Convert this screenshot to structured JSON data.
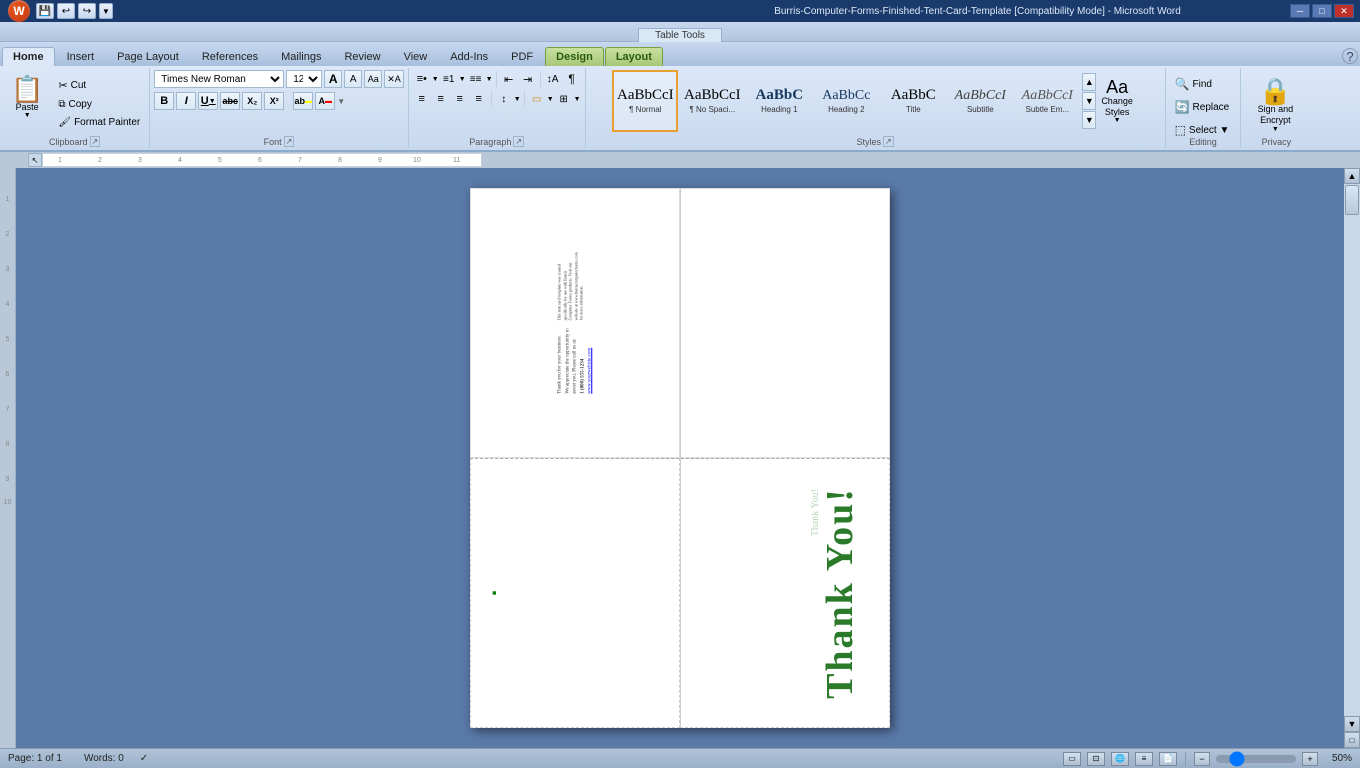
{
  "titlebar": {
    "title": "Burris-Computer-Forms-Finished-Tent-Card-Template [Compatibility Mode] - Microsoft Word",
    "win_min": "─",
    "win_max": "□",
    "win_close": "✕"
  },
  "quickaccess": {
    "save_label": "💾",
    "undo_label": "↩",
    "redo_label": "↪",
    "customize_label": "▼"
  },
  "tabletools": {
    "label": "Table Tools"
  },
  "tabs": [
    {
      "id": "home",
      "label": "Home",
      "active": true,
      "contextual": false
    },
    {
      "id": "insert",
      "label": "Insert",
      "active": false,
      "contextual": false
    },
    {
      "id": "pagelayout",
      "label": "Page Layout",
      "active": false,
      "contextual": false
    },
    {
      "id": "references",
      "label": "References",
      "active": false,
      "contextual": false
    },
    {
      "id": "mailings",
      "label": "Mailings",
      "active": false,
      "contextual": false
    },
    {
      "id": "review",
      "label": "Review",
      "active": false,
      "contextual": false
    },
    {
      "id": "view",
      "label": "View",
      "active": false,
      "contextual": false
    },
    {
      "id": "addins",
      "label": "Add-Ins",
      "active": false,
      "contextual": false
    },
    {
      "id": "pdf",
      "label": "PDF",
      "active": false,
      "contextual": false
    },
    {
      "id": "design",
      "label": "Design",
      "active": false,
      "contextual": true
    },
    {
      "id": "layout",
      "label": "Layout",
      "active": false,
      "contextual": true
    }
  ],
  "ribbon": {
    "clipboard": {
      "group_label": "Clipboard",
      "paste_label": "Paste",
      "cut_label": "Cut",
      "copy_label": "Copy",
      "format_painter_label": "Format Painter"
    },
    "font": {
      "group_label": "Font",
      "font_name": "Times New Roman",
      "font_size": "12",
      "grow_label": "A",
      "shrink_label": "A",
      "clear_label": "Aa",
      "bold_label": "B",
      "italic_label": "I",
      "underline_label": "U",
      "strikethrough_label": "abc",
      "subscript_label": "X₂",
      "superscript_label": "X²",
      "highlight_label": "ab",
      "color_label": "A"
    },
    "paragraph": {
      "group_label": "Paragraph",
      "bullets_label": "≡•",
      "numbering_label": "≡1",
      "multilevel_label": "≡≡",
      "decrease_indent_label": "⇤",
      "increase_indent_label": "⇥",
      "sort_label": "↕A",
      "show_hide_label": "¶",
      "align_left_label": "≡",
      "align_center_label": "≡",
      "align_right_label": "≡",
      "justify_label": "≡",
      "line_spacing_label": "↕",
      "shading_label": "░",
      "borders_label": "⊞"
    },
    "styles": {
      "group_label": "Styles",
      "items": [
        {
          "id": "normal",
          "preview": "AaBbCcI",
          "label": "¶ Normal",
          "selected": true
        },
        {
          "id": "no-spacing",
          "preview": "AaBbCcI",
          "label": "¶ No Spaci..."
        },
        {
          "id": "heading1",
          "preview": "AaBbC",
          "label": "Heading 1"
        },
        {
          "id": "heading2",
          "preview": "AaBbC",
          "label": "Heading 2"
        },
        {
          "id": "title",
          "preview": "AaBbC",
          "label": "Title"
        },
        {
          "id": "subtitle",
          "preview": "AaBbCcI",
          "label": "Subtitle"
        },
        {
          "id": "subtle-em",
          "preview": "AaBbCcI",
          "label": "Subtle Em..."
        }
      ],
      "change_styles_label": "Change\nStyles",
      "scroll_up": "▲",
      "scroll_down": "▼",
      "more": "▼"
    },
    "editing": {
      "group_label": "Editing",
      "find_label": "Find",
      "replace_label": "Replace",
      "select_label": "Select ▼"
    },
    "privacy": {
      "group_label": "Privacy",
      "sign_encrypt_label": "Sign and\nEncrypt"
    }
  },
  "document": {
    "page_info": "Page: 1 of 1",
    "words_info": "Words: 0",
    "zoom_level": "50%",
    "top_left_text_lines": [
      "Thank you for your business.",
      "We appreciate the opportunity to",
      "assist you. Please call us at:",
      "1 (800) 555-1234",
      "www.yourwebsite.com"
    ],
    "thank_you_text": "Thank You!"
  },
  "statusbar": {
    "page_label": "Page: 1 of 1",
    "words_label": "Words: 0",
    "check_icon": "✓",
    "zoom_percent": "50%"
  }
}
